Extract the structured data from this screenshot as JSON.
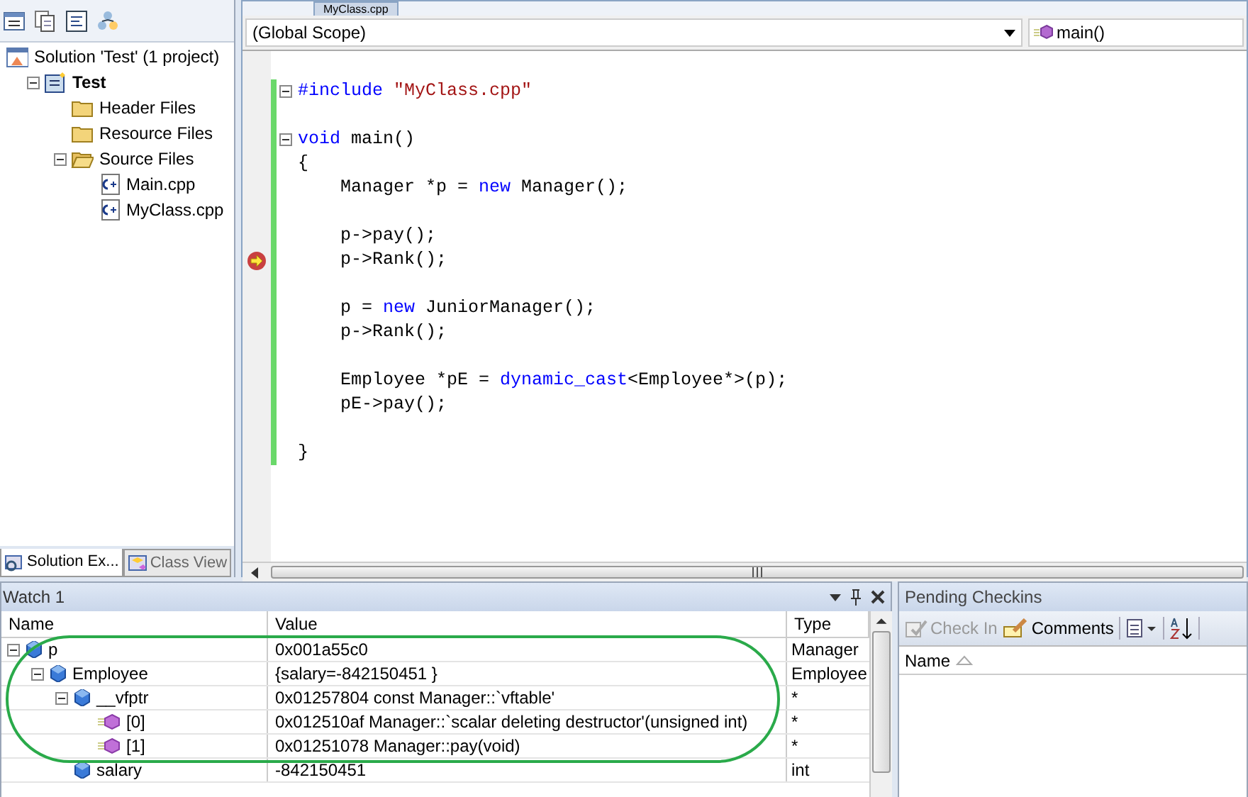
{
  "solution_explorer": {
    "tree": [
      {
        "label": "Solution 'Test' (1 project)",
        "kind": "solution",
        "expanded": true,
        "children": [
          {
            "label": "Test",
            "kind": "project",
            "expanded": true,
            "children": [
              {
                "label": "Header Files",
                "kind": "folder",
                "expanded": false
              },
              {
                "label": "Resource Files",
                "kind": "folder",
                "expanded": false
              },
              {
                "label": "Source Files",
                "kind": "folder",
                "expanded": true,
                "children": [
                  {
                    "label": "Main.cpp",
                    "kind": "file"
                  },
                  {
                    "label": "MyClass.cpp",
                    "kind": "file"
                  }
                ]
              }
            ]
          }
        ]
      }
    ],
    "tabs": [
      {
        "label": "Solution Ex...",
        "selected": true
      },
      {
        "label": "Class View",
        "selected": false
      }
    ]
  },
  "editor": {
    "tabs": [
      {
        "label": "MyClass.cpp",
        "selected": false
      }
    ],
    "scope": "(Global Scope)",
    "member": "main()",
    "lines": [
      {
        "expanded": true,
        "tokens": [
          {
            "kind": "keyword",
            "text": "#include "
          },
          {
            "kind": "string",
            "text": "\"MyClass.cpp\""
          }
        ]
      },
      {
        "expanded": true,
        "space_before": true,
        "tokens": [
          {
            "kind": "keyword",
            "text": "void"
          },
          {
            "kind": "plain",
            "text": " main()"
          }
        ]
      },
      {
        "tokens": [
          {
            "kind": "plain",
            "text": "{"
          }
        ]
      },
      {
        "tokens": [
          {
            "kind": "plain",
            "text": "    Manager *p = "
          },
          {
            "kind": "keyword",
            "text": "new"
          },
          {
            "kind": "plain",
            "text": " Manager();"
          }
        ]
      },
      {
        "space_before": true,
        "tokens": [
          {
            "kind": "plain",
            "text": "    p->pay();"
          }
        ]
      },
      {
        "current": true,
        "tokens": [
          {
            "kind": "plain",
            "text": "    p->Rank();"
          }
        ]
      },
      {
        "space_before": true,
        "tokens": [
          {
            "kind": "plain",
            "text": "    p = "
          },
          {
            "kind": "keyword",
            "text": "new"
          },
          {
            "kind": "plain",
            "text": " JuniorManager();"
          }
        ]
      },
      {
        "tokens": [
          {
            "kind": "plain",
            "text": "    p->Rank();"
          }
        ]
      },
      {
        "space_before": true,
        "tokens": [
          {
            "kind": "plain",
            "text": "    Employee *pE = "
          },
          {
            "kind": "keyword",
            "text": "dynamic_cast"
          },
          {
            "kind": "plain",
            "text": "<Employee*>(p);"
          }
        ]
      },
      {
        "tokens": [
          {
            "kind": "plain",
            "text": "    pE->pay();"
          }
        ]
      },
      {
        "space_before": true,
        "tokens": [
          {
            "kind": "plain",
            "text": "}"
          }
        ]
      }
    ]
  },
  "watch": {
    "title": "Watch 1",
    "columns": [
      "Name",
      "Value",
      "Type"
    ],
    "rows": [
      {
        "name": "p",
        "value": "0x001a55c0",
        "type": "Manager",
        "kind": "field",
        "expanded": true,
        "children": [
          {
            "name": "Employee",
            "value": "{salary=-842150451 }",
            "type": "Employee",
            "kind": "field",
            "expanded": true,
            "children": [
              {
                "name": "__vfptr",
                "value": "0x01257804 const Manager::`vftable'",
                "type": "*",
                "kind": "field",
                "expanded": true,
                "children": [
                  {
                    "name": "[0]",
                    "value": "0x012510af Manager::`scalar deleting destructor'(unsigned int)",
                    "type": "*",
                    "kind": "method"
                  },
                  {
                    "name": "[1]",
                    "value": "0x01251078 Manager::pay(void)",
                    "type": "*",
                    "kind": "method"
                  }
                ]
              },
              {
                "name": "salary",
                "value": "-842150451",
                "type": "int",
                "kind": "field"
              }
            ]
          }
        ]
      }
    ]
  },
  "pending_checkins": {
    "title": "Pending Checkins",
    "toolbar": [
      {
        "label": "Check In",
        "disabled": true
      },
      {
        "label": "Comments",
        "disabled": false
      }
    ],
    "column": "Name"
  }
}
